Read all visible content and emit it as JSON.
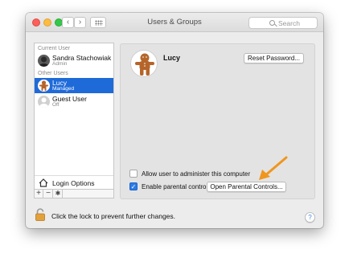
{
  "window": {
    "title": "Users & Groups"
  },
  "search": {
    "placeholder": "Search"
  },
  "sidebar": {
    "current_user_label": "Current User",
    "other_users_label": "Other Users",
    "users": [
      {
        "name": "Sandra Stachowiak",
        "role": "Admin"
      },
      {
        "name": "Lucy",
        "role": "Managed"
      },
      {
        "name": "Guest User",
        "role": "Off"
      }
    ],
    "login_options": "Login Options",
    "add": "+",
    "remove": "−"
  },
  "detail": {
    "user_name": "Lucy",
    "reset_password": "Reset Password...",
    "allow_admin": "Allow user to administer this computer",
    "allow_admin_checked": false,
    "enable_parental": "Enable parental controls",
    "enable_parental_checked": true,
    "open_parental": "Open Parental Controls..."
  },
  "footer": {
    "lock_text": "Click the lock to prevent further changes.",
    "help": "?"
  },
  "colors": {
    "selection": "#1f6ad9",
    "annotation_arrow": "#f0961e"
  }
}
